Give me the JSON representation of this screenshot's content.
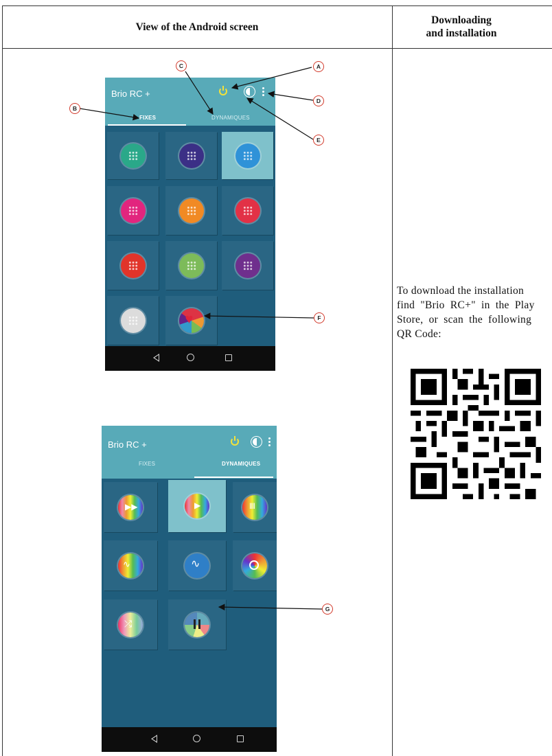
{
  "table": {
    "header_left": "View of the Android screen",
    "header_right_line1": "Downloading",
    "header_right_line2": "and installation"
  },
  "app": {
    "title": "Brio RC +",
    "tab_fixes": "FIXES",
    "tab_dynamiques": "DYNAMIQUES"
  },
  "screen1": {
    "active_tab": "FIXES",
    "selected_index": 2,
    "colors": [
      "#2aa889",
      "#3b2f86",
      "#2f92d8",
      "#e2257e",
      "#f18a24",
      "#e23146",
      "#e1342a",
      "#7dbb5a",
      "#6f2f8d",
      "#dcdcdc",
      "heart"
    ]
  },
  "screen2": {
    "active_tab": "DYNAMIQUES",
    "selected_index": 1,
    "icons": [
      "fast-forward-icon",
      "play-icon",
      "audio-wave-icon",
      "pulse-icon",
      "sine-wave-icon",
      "color-wheel-icon",
      "shuffle-icon",
      "pause-icon"
    ]
  },
  "callouts": {
    "A": "A",
    "B": "B",
    "C": "C",
    "D": "D",
    "E": "E",
    "F": "F",
    "G": "G"
  },
  "download": {
    "line1": "To download the installation",
    "line2": "find \"Brio RC+\" in the Play",
    "line3": "Store, or scan the following",
    "line4": "QR Code:"
  },
  "colors": {
    "appbar": "#58aab8",
    "screen_bg": "#1f5d7c",
    "callout_red": "#d23a2b"
  }
}
